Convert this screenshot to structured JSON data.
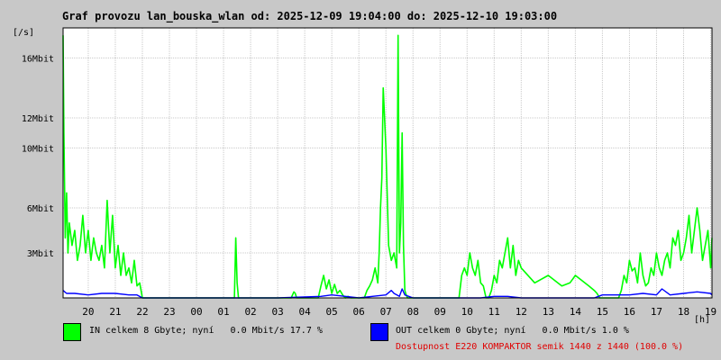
{
  "title": "Graf provozu lan_bouska_wlan od: 2025-12-09 19:04:00 do: 2025-12-10 19:03:00",
  "y_unit": "[/s]",
  "x_unit": "[h]",
  "legend": {
    "in": {
      "label": "IN celkem 8 Gbyte; nyní   0.0 Mbit/s 17.7 %",
      "color": "#00ff00"
    },
    "out": {
      "label": "OUT celkem 0 Gbyte; nyní   0.0 Mbit/s 1.0 %",
      "color": "#0000ff"
    },
    "availability": "Dostupnost E220 KOMPAKTOR semik 1440 z 1440 (100.0 %)"
  },
  "chart_data": {
    "type": "area",
    "title": "Graf provozu lan_bouska_wlan od: 2025-12-09 19:04:00 do: 2025-12-10 19:03:00",
    "ylabel": "[/s]",
    "xlabel": "[h]",
    "x_tick_labels": [
      "20",
      "21",
      "22",
      "23",
      "00",
      "01",
      "02",
      "03",
      "04",
      "05",
      "06",
      "07",
      "08",
      "09",
      "10",
      "11",
      "12",
      "13",
      "14",
      "15",
      "16",
      "17",
      "18",
      "19"
    ],
    "y_tick_labels": [
      {
        "label": "3Mbit",
        "value": 3
      },
      {
        "label": "6Mbit",
        "value": 6
      },
      {
        "label": "10Mbit",
        "value": 10
      },
      {
        "label": "12Mbit",
        "value": 12
      },
      {
        "label": "16Mbit",
        "value": 16
      }
    ],
    "ylim": [
      0,
      18
    ],
    "xlim": [
      19.07,
      43.05
    ],
    "grid": true,
    "series": [
      {
        "name": "IN",
        "color": "#00ff00",
        "x_hours": [
          19.07,
          19.1,
          19.15,
          19.2,
          19.25,
          19.3,
          19.4,
          19.5,
          19.6,
          19.7,
          19.8,
          19.9,
          20.0,
          20.1,
          20.2,
          20.3,
          20.4,
          20.5,
          20.6,
          20.7,
          20.8,
          20.9,
          21.0,
          21.1,
          21.2,
          21.3,
          21.4,
          21.5,
          21.6,
          21.7,
          21.8,
          21.9,
          22.0,
          22.5,
          23.0,
          23.5,
          24.0,
          24.5,
          25.0,
          25.4,
          25.45,
          25.5,
          25.55,
          25.6,
          26.0,
          26.5,
          27.0,
          27.5,
          27.6,
          27.65,
          27.7,
          28.0,
          28.5,
          28.6,
          28.7,
          28.8,
          28.9,
          29.0,
          29.1,
          29.2,
          29.3,
          29.4,
          29.5,
          29.6,
          29.7,
          29.8,
          29.9,
          30.0,
          30.1,
          30.2,
          30.3,
          30.4,
          30.5,
          30.6,
          30.7,
          30.75,
          30.8,
          30.85,
          30.9,
          31.0,
          31.1,
          31.2,
          31.3,
          31.4,
          31.45,
          31.5,
          31.55,
          31.6,
          31.65,
          31.7,
          31.75,
          31.8,
          31.9,
          32.0,
          32.2,
          32.5,
          33.0,
          33.4,
          33.5,
          33.6,
          33.7,
          33.8,
          33.9,
          34.0,
          34.1,
          34.2,
          34.3,
          34.4,
          34.5,
          34.6,
          34.7,
          34.8,
          34.9,
          35.0,
          35.1,
          35.2,
          35.3,
          35.4,
          35.5,
          35.6,
          35.7,
          35.8,
          35.9,
          36.0,
          36.5,
          37.0,
          37.5,
          37.8,
          38.0,
          38.5,
          38.7,
          38.8,
          38.9,
          39.0,
          39.1,
          39.2,
          39.3,
          39.4,
          39.5,
          39.6,
          39.7,
          39.8,
          39.9,
          40.0,
          40.1,
          40.2,
          40.3,
          40.4,
          40.5,
          40.6,
          40.7,
          40.8,
          40.9,
          41.0,
          41.1,
          41.2,
          41.3,
          41.4,
          41.5,
          41.6,
          41.7,
          41.8,
          41.9,
          42.0,
          42.1,
          42.2,
          42.3,
          42.4,
          42.5,
          42.6,
          42.7,
          42.8,
          42.9,
          43.0,
          43.05
        ],
        "values_mbit": [
          17.5,
          11.0,
          4.0,
          7.0,
          3.0,
          5.0,
          3.5,
          4.5,
          2.5,
          3.5,
          5.5,
          3.0,
          4.5,
          2.5,
          4.0,
          3.0,
          2.5,
          3.5,
          2.0,
          6.5,
          3.0,
          5.5,
          2.0,
          3.5,
          1.5,
          3.0,
          1.5,
          2.0,
          1.0,
          2.5,
          0.8,
          1.0,
          0,
          0,
          0,
          0,
          0,
          0,
          0,
          0,
          4.0,
          1.0,
          0,
          0,
          0,
          0,
          0,
          0,
          0.4,
          0.3,
          0,
          0,
          0,
          0.8,
          1.5,
          0.6,
          1.2,
          0.3,
          0.9,
          0.3,
          0.5,
          0.2,
          0,
          0.1,
          0,
          0,
          0,
          0,
          0,
          0,
          0.5,
          0.8,
          1.2,
          2.0,
          1.0,
          3.0,
          6.0,
          8.0,
          14.0,
          10.0,
          3.5,
          2.5,
          3.0,
          2.0,
          17.5,
          3.0,
          5.0,
          11.0,
          3.5,
          0.5,
          0.2,
          0,
          0,
          0,
          0,
          0,
          0,
          0,
          0,
          0,
          0,
          1.5,
          2.0,
          1.5,
          3.0,
          2.0,
          1.5,
          2.5,
          1.0,
          0.8,
          0,
          0,
          0.5,
          1.5,
          1.0,
          2.5,
          2.0,
          3.0,
          4.0,
          2.0,
          3.5,
          1.5,
          2.5,
          2.0,
          1.0,
          1.5,
          0.8,
          1.0,
          1.5,
          0.8,
          0.5,
          0.3,
          0,
          0,
          0,
          0,
          0,
          0,
          0,
          0,
          0.5,
          1.5,
          1.0,
          2.5,
          1.8,
          2.0,
          1.0,
          3.0,
          1.5,
          0.8,
          1.0,
          2.0,
          1.5,
          3.0,
          2.0,
          1.5,
          2.5,
          3.0,
          2.0,
          4.0,
          3.5,
          4.5,
          2.5,
          3.0,
          4.0,
          5.5,
          3.0,
          4.5,
          6.0,
          4.5,
          2.5,
          3.5,
          4.5,
          2.0,
          4.0,
          5.0,
          4.0,
          4.5,
          3.5,
          2.5,
          3.5,
          2.0,
          1.8,
          2.2,
          2.0
        ]
      },
      {
        "name": "OUT",
        "color": "#0000ff",
        "x_hours": [
          19.07,
          19.2,
          19.5,
          20.0,
          20.5,
          21.0,
          21.5,
          21.8,
          22.0,
          25.0,
          27.0,
          28.6,
          29.0,
          29.5,
          30.0,
          30.5,
          31.0,
          31.2,
          31.3,
          31.5,
          31.6,
          31.7,
          32.0,
          34.5,
          35.0,
          35.5,
          36.0,
          36.5,
          38.7,
          39.0,
          39.5,
          40.0,
          40.5,
          41.0,
          41.2,
          41.5,
          42.0,
          42.5,
          43.0,
          43.05
        ],
        "values_mbit": [
          0.5,
          0.3,
          0.3,
          0.2,
          0.3,
          0.3,
          0.2,
          0.2,
          0,
          0,
          0,
          0.1,
          0.2,
          0.1,
          0,
          0.1,
          0.2,
          0.5,
          0.3,
          0.1,
          0.6,
          0.2,
          0,
          0,
          0.1,
          0.1,
          0,
          0,
          0,
          0.2,
          0.2,
          0.2,
          0.3,
          0.2,
          0.6,
          0.2,
          0.3,
          0.4,
          0.3,
          0.2
        ]
      }
    ]
  }
}
